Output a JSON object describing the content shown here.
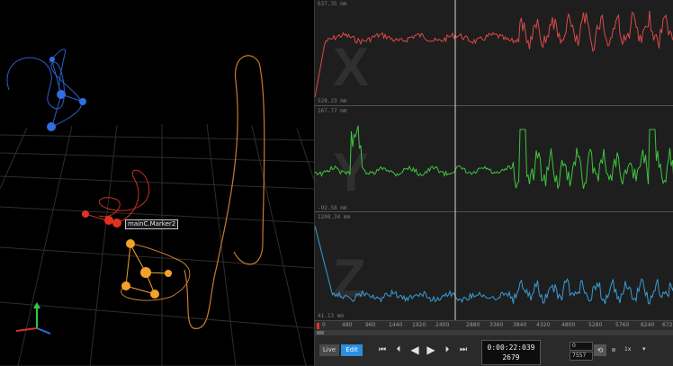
{
  "viewport": {
    "marker_label": "mainC.Marker2"
  },
  "graphs": {
    "x": {
      "axis_letter": "X",
      "max_label": "637.35 mm",
      "min_label": "528.23 mm",
      "color": "#d94a45"
    },
    "y": {
      "axis_letter": "Y",
      "max_label": "167.77 mm",
      "min_label": "-92.58 mm",
      "color": "#3fc43f"
    },
    "z": {
      "axis_letter": "Z",
      "max_label": "1208.34 mm",
      "min_label": "41.13 mm",
      "color": "#3a9bd6"
    }
  },
  "timeline": {
    "ticks": [
      "0",
      "480",
      "960",
      "1440",
      "1920",
      "2400",
      "2880",
      "3360",
      "3840",
      "4320",
      "4800",
      "5280",
      "5760",
      "6240",
      "672"
    ],
    "playhead_frame": "2679"
  },
  "transport": {
    "live_label": "Live",
    "edit_label": "Edit",
    "time": "0:00:22:039",
    "frame": "2679",
    "range_start": "0",
    "range_end": "7557",
    "speed": "1x",
    "icons": {
      "first": "skip-to-start-icon",
      "prev": "step-back-icon",
      "play_back": "play-reverse-icon",
      "play": "play-icon",
      "next": "step-forward-icon",
      "last": "skip-to-end-icon",
      "loop": "loop-icon"
    }
  },
  "colors": {
    "marker_blue": "#2f6fe0",
    "marker_red": "#e2321f",
    "marker_orange": "#f2a22a",
    "trail_orange": "#c97a2b",
    "edit_active": "#2a8fe0"
  }
}
